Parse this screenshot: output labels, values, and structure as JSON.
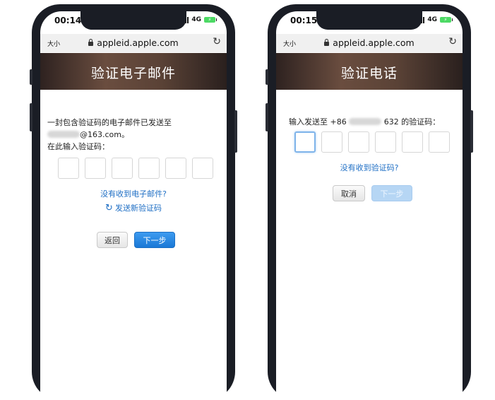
{
  "left_phone": {
    "status": {
      "time": "00:14",
      "network": "4G"
    },
    "browser": {
      "text_size": "大小",
      "url": "appleid.apple.com",
      "reload_icon": "reload-icon"
    },
    "banner_title": "验证电子邮件",
    "message_line1": "一封包含验证码的电子邮件已发送至",
    "email_domain": "@163.com。",
    "prompt": "在此输入验证码：",
    "no_email_link": "没有收到电子邮件?",
    "resend_link": "发送新验证码",
    "back_button": "返回",
    "next_button": "下一步"
  },
  "right_phone": {
    "status": {
      "time": "00:15",
      "network": "4G"
    },
    "browser": {
      "text_size": "大小",
      "url": "appleid.apple.com",
      "reload_icon": "reload-icon"
    },
    "banner_title": "验证电话",
    "prompt_prefix": "输入发送至 +86",
    "prompt_suffix": "632 的验证码：",
    "no_code_link": "没有收到验证码?",
    "cancel_button": "取消",
    "next_button": "下一步"
  },
  "colors": {
    "link": "#1f6fc5",
    "primary_button": "#1a78d6",
    "disabled_button": "#b6d6f4"
  }
}
